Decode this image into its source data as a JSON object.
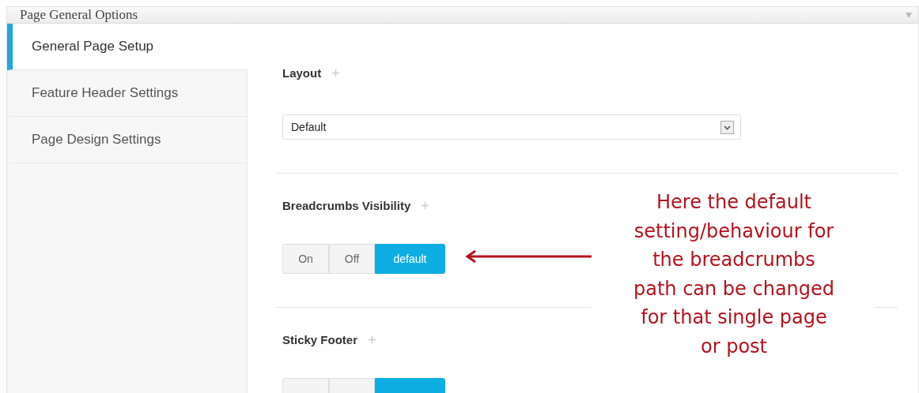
{
  "panel": {
    "title": "Page General Options"
  },
  "sidebar": {
    "items": [
      {
        "label": "General Page Setup",
        "selected": true
      },
      {
        "label": "Feature Header Settings",
        "selected": false
      },
      {
        "label": "Page Design Settings",
        "selected": false
      }
    ]
  },
  "fields": [
    {
      "kind": "select",
      "label": "Layout",
      "value": "Default"
    },
    {
      "kind": "toggle",
      "label": "Breadcrumbs Visibility",
      "options": [
        {
          "label": "On",
          "selected": false
        },
        {
          "label": "Off",
          "selected": false
        },
        {
          "label": "default",
          "selected": true
        }
      ]
    },
    {
      "kind": "toggle",
      "label": "Sticky Footer",
      "options": [
        {
          "selected": false
        },
        {
          "selected": false
        },
        {
          "selected": true
        }
      ]
    }
  ],
  "annotation": {
    "text": "Here the default\nsetting/behaviour for\nthe breadcrumbs\npath can be changed\nfor that single page\nor post"
  }
}
